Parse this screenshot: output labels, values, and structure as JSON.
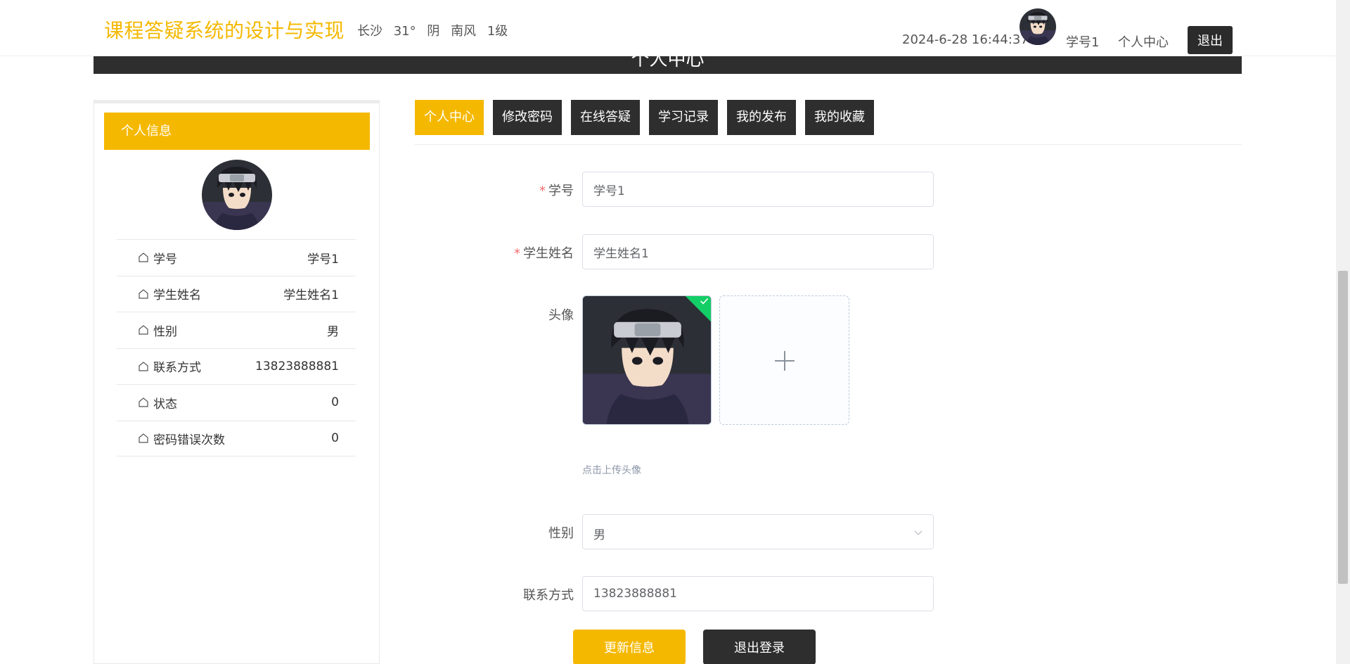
{
  "header": {
    "site_title": "课程答疑系统的设计与实现",
    "weather": {
      "city": "长沙",
      "temperature": "31°",
      "condition": "阴",
      "wind": "南风",
      "level": "1级"
    },
    "datetime": "2024-6-28 16:44:37",
    "username": "学号1",
    "personal_center_link": "个人中心",
    "logout_label": "退出"
  },
  "banner": {
    "title": "个人中心"
  },
  "sidebar": {
    "header": "个人信息",
    "items": [
      {
        "label": "学号",
        "value": "学号1"
      },
      {
        "label": "学生姓名",
        "value": "学生姓名1"
      },
      {
        "label": "性别",
        "value": "男"
      },
      {
        "label": "联系方式",
        "value": "13823888881"
      },
      {
        "label": "状态",
        "value": "0"
      },
      {
        "label": "密码错误次数",
        "value": "0"
      }
    ]
  },
  "tabs": [
    {
      "label": "个人中心",
      "active": true
    },
    {
      "label": "修改密码",
      "active": false
    },
    {
      "label": "在线答疑",
      "active": false
    },
    {
      "label": "学习记录",
      "active": false
    },
    {
      "label": "我的发布",
      "active": false
    },
    {
      "label": "我的收藏",
      "active": false
    }
  ],
  "form": {
    "student_id": {
      "label": "学号",
      "value": "学号1",
      "required_mark": "*"
    },
    "student_name": {
      "label": "学生姓名",
      "value": "学生姓名1",
      "required_mark": "*"
    },
    "avatar": {
      "label": "头像",
      "tip": "点击上传头像"
    },
    "gender": {
      "label": "性别",
      "value": "男"
    },
    "phone": {
      "label": "联系方式",
      "value": "13823888881"
    },
    "update_button": "更新信息",
    "logout_button": "退出登录"
  },
  "colors": {
    "accent": "#f5b800",
    "dark": "#2e2e2e",
    "success": "#13ce66"
  }
}
